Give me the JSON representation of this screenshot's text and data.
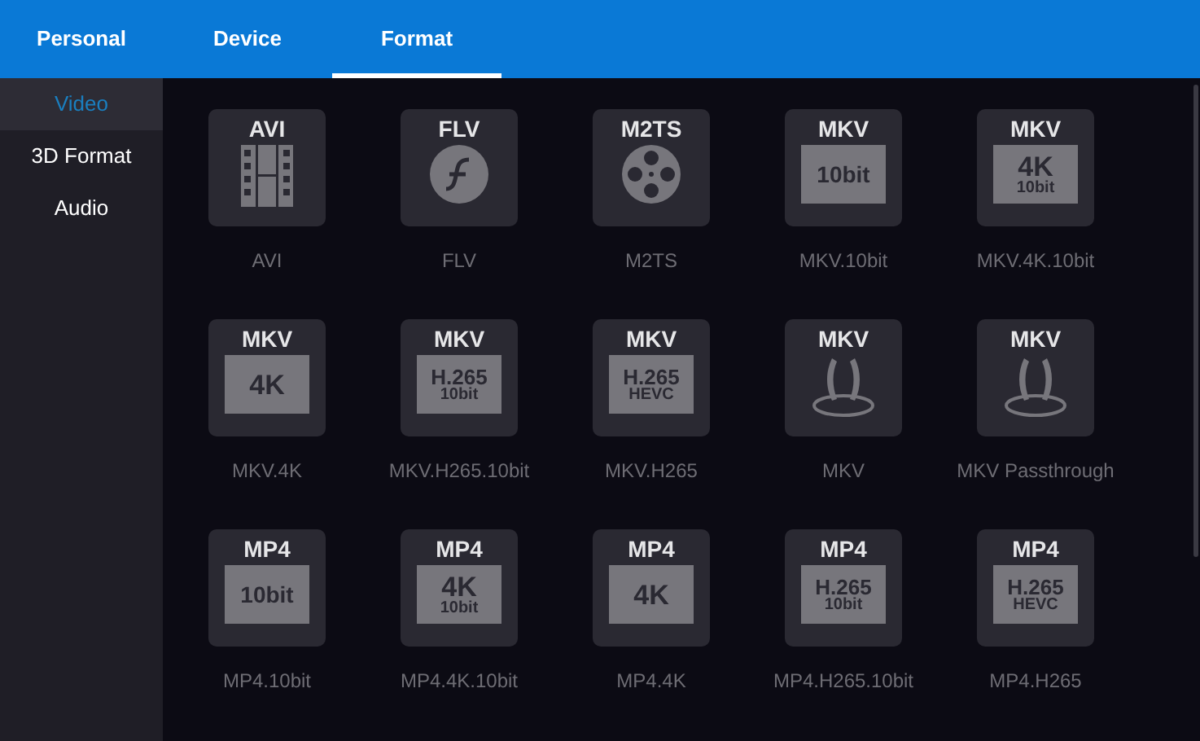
{
  "tabs": [
    {
      "label": "Personal",
      "selected": false
    },
    {
      "label": "Device",
      "selected": false
    },
    {
      "label": "Format",
      "selected": true
    }
  ],
  "sidebar": {
    "items": [
      {
        "label": "Video",
        "selected": true
      },
      {
        "label": "3D Format",
        "selected": false
      },
      {
        "label": "Audio",
        "selected": false
      }
    ]
  },
  "formats": [
    {
      "badge": "AVI",
      "kind": "film",
      "label": "AVI"
    },
    {
      "badge": "FLV",
      "kind": "flash",
      "label": "FLV"
    },
    {
      "badge": "M2TS",
      "kind": "reel",
      "label": "M2TS"
    },
    {
      "badge": "MKV",
      "kind": "box",
      "lines": [
        "10bit"
      ],
      "label": "MKV.10bit"
    },
    {
      "badge": "MKV",
      "kind": "box",
      "lines": [
        "4K",
        "10bit"
      ],
      "label": "MKV.4K.10bit"
    },
    {
      "badge": "MKV",
      "kind": "box",
      "lines": [
        "4K"
      ],
      "label": "MKV.4K"
    },
    {
      "badge": "MKV",
      "kind": "box",
      "lines": [
        "H.265",
        "10bit"
      ],
      "label": "MKV.H265.10bit"
    },
    {
      "badge": "MKV",
      "kind": "box",
      "lines": [
        "H.265",
        "HEVC"
      ],
      "label": "MKV.H265"
    },
    {
      "badge": "MKV",
      "kind": "surround",
      "label": "MKV"
    },
    {
      "badge": "MKV",
      "kind": "surround",
      "label": "MKV Passthrough"
    },
    {
      "badge": "MP4",
      "kind": "box",
      "lines": [
        "10bit"
      ],
      "label": "MP4.10bit"
    },
    {
      "badge": "MP4",
      "kind": "box",
      "lines": [
        "4K",
        "10bit"
      ],
      "label": "MP4.4K.10bit"
    },
    {
      "badge": "MP4",
      "kind": "box",
      "lines": [
        "4K"
      ],
      "label": "MP4.4K"
    },
    {
      "badge": "MP4",
      "kind": "box",
      "lines": [
        "H.265",
        "10bit"
      ],
      "label": "MP4.H265.10bit"
    },
    {
      "badge": "MP4",
      "kind": "box",
      "lines": [
        "H.265",
        "HEVC"
      ],
      "label": "MP4.H265"
    }
  ]
}
